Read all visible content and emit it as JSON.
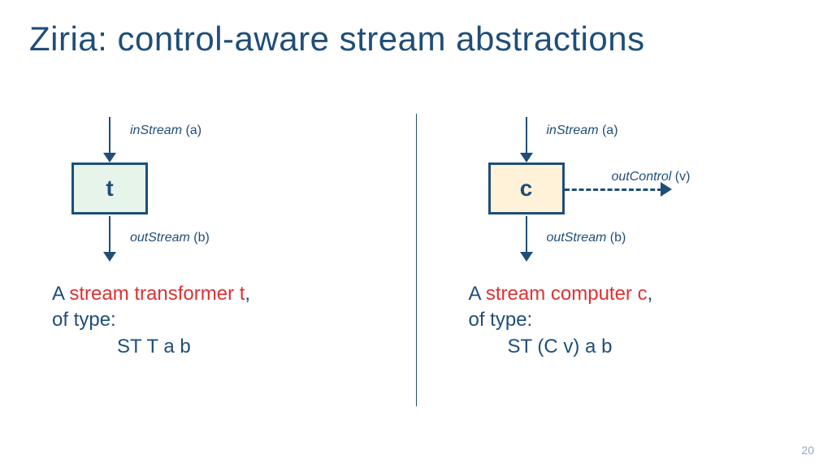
{
  "title": "Ziria: control-aware stream abstractions",
  "left": {
    "inLabelItalic": "inStream",
    "inLabelParen": " (a)",
    "boxLabel": "t",
    "outLabelItalic": "outStream",
    "outLabelParen": " (b)",
    "descPrefix": "A ",
    "descRed": "stream transformer t",
    "descComma": ",",
    "descLine2": "of type:",
    "descType": "ST T a b"
  },
  "right": {
    "inLabelItalic": "inStream",
    "inLabelParen": " (a)",
    "boxLabel": "c",
    "ctlLabelItalic": "outControl",
    "ctlLabelParen": " (v)",
    "outLabelItalic": "outStream",
    "outLabelParen": " (b)",
    "descPrefix": "A ",
    "descRed": "stream computer c",
    "descComma": ",",
    "descLine2": "of type:",
    "descType": "ST (C v) a b"
  },
  "pageNumber": "20"
}
